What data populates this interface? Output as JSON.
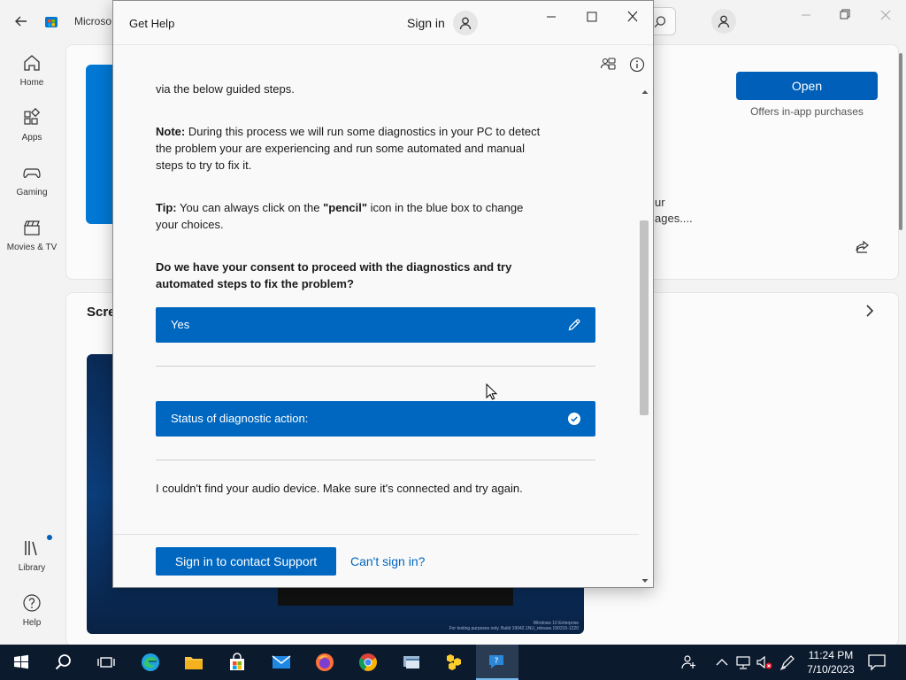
{
  "store": {
    "title": "Microso",
    "nav": {
      "home": "Home",
      "apps": "Apps",
      "gaming": "Gaming",
      "movies": "Movies & TV",
      "library": "Library",
      "help": "Help"
    },
    "open_label": "Open",
    "offers": "Offers in-app purchases",
    "desc_line1": "ur",
    "desc_line2": "ages....",
    "section_title": "Scre",
    "screenshot_watermark": "Windows 10 Enterprise\nFor testing purposes only. Build 19042.1NU_release.190315-1220"
  },
  "gethelp": {
    "title": "Get Help",
    "sign_in": "Sign in",
    "intro": "via the below guided steps.",
    "note_label": "Note:",
    "note_text": " During this process we will run some diagnostics in your PC to detect the problem your are experiencing and run some automated and manual steps to try to fix it.",
    "tip_label": "Tip:",
    "tip_text_1": " You can always click on the ",
    "tip_bold": "\"pencil\"",
    "tip_text_2": " icon in the blue box to change your choices.",
    "question": "Do we have your consent to proceed with the diagnostics and try automated steps to fix the problem?",
    "yes_choice": "Yes",
    "status_label": "Status of diagnostic action:",
    "result": "I couldn't find your audio device. Make sure it's connected and try again.",
    "contact_label": "Sign in to contact Support",
    "cant_sign_in": "Can't sign in?"
  },
  "taskbar": {
    "time": "11:24 PM",
    "date": "7/10/2023"
  },
  "colors": {
    "accent": "#0067c0",
    "store_accent": "#005fb8",
    "taskbar": "#0c1a2e"
  }
}
